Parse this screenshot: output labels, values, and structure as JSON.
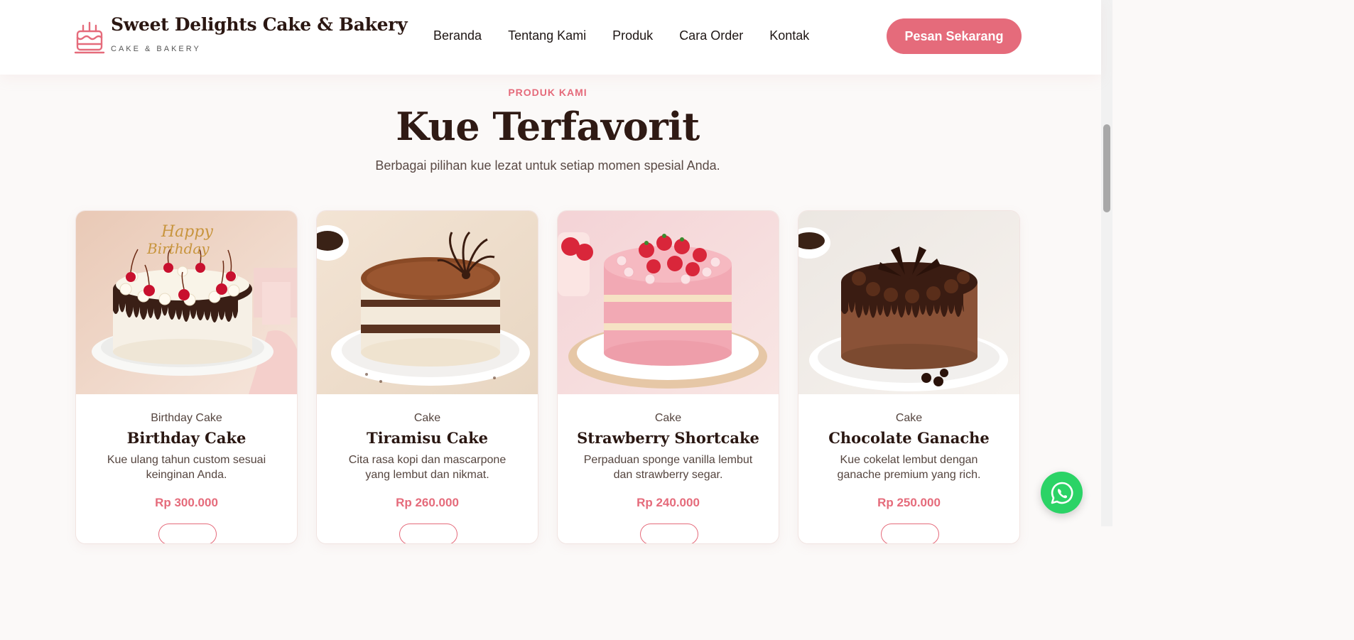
{
  "header": {
    "brand_title": "Sweet Delights Cake & Bakery",
    "brand_subtitle": "CAKE & BAKERY",
    "brand_icon": "cake-icon",
    "nav": [
      "Beranda",
      "Tentang Kami",
      "Produk",
      "Cara Order",
      "Kontak"
    ],
    "cta_label": "Pesan Sekarang"
  },
  "section": {
    "eyebrow": "PRODUK KAMI",
    "title": "Kue Terfavorit",
    "subtitle": "Berbagai pilihan kue lezat untuk setiap momen spesial Anda."
  },
  "products": [
    {
      "category": "Birthday Cake",
      "name": "Birthday Cake",
      "description": "Kue ulang tahun custom sesuai keinginan Anda.",
      "price": "Rp 300.000",
      "topper_text_1": "Happy",
      "topper_text_2": "Birthday"
    },
    {
      "category": "Cake",
      "name": "Tiramisu Cake",
      "description": "Cita rasa kopi dan mascarpone yang lembut dan nikmat.",
      "price": "Rp 260.000"
    },
    {
      "category": "Cake",
      "name": "Strawberry Shortcake",
      "description": "Perpaduan sponge vanilla lembut dan strawberry segar.",
      "price": "Rp 240.000"
    },
    {
      "category": "Cake",
      "name": "Chocolate Ganache",
      "description": "Kue cokelat lembut dengan ganache premium yang rich.",
      "price": "Rp 250.000"
    }
  ],
  "floating": {
    "whatsapp_icon": "whatsapp-icon"
  },
  "colors": {
    "accent": "#e56b7b",
    "dark": "#2f1a14",
    "whatsapp": "#2bd366"
  }
}
